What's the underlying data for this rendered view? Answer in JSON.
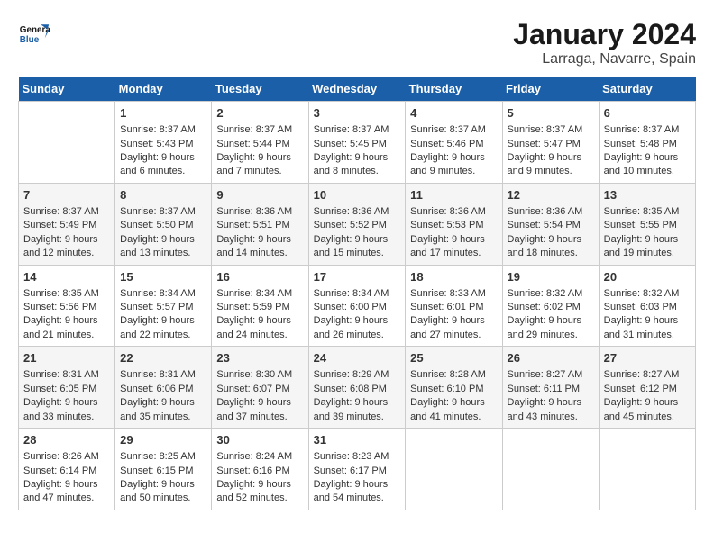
{
  "header": {
    "logo": "GeneralBlue",
    "month": "January 2024",
    "location": "Larraga, Navarre, Spain"
  },
  "columns": [
    "Sunday",
    "Monday",
    "Tuesday",
    "Wednesday",
    "Thursday",
    "Friday",
    "Saturday"
  ],
  "weeks": [
    [
      {
        "day": "",
        "sunrise": "",
        "sunset": "",
        "daylight": ""
      },
      {
        "day": "1",
        "sunrise": "Sunrise: 8:37 AM",
        "sunset": "Sunset: 5:43 PM",
        "daylight": "Daylight: 9 hours and 6 minutes."
      },
      {
        "day": "2",
        "sunrise": "Sunrise: 8:37 AM",
        "sunset": "Sunset: 5:44 PM",
        "daylight": "Daylight: 9 hours and 7 minutes."
      },
      {
        "day": "3",
        "sunrise": "Sunrise: 8:37 AM",
        "sunset": "Sunset: 5:45 PM",
        "daylight": "Daylight: 9 hours and 8 minutes."
      },
      {
        "day": "4",
        "sunrise": "Sunrise: 8:37 AM",
        "sunset": "Sunset: 5:46 PM",
        "daylight": "Daylight: 9 hours and 9 minutes."
      },
      {
        "day": "5",
        "sunrise": "Sunrise: 8:37 AM",
        "sunset": "Sunset: 5:47 PM",
        "daylight": "Daylight: 9 hours and 9 minutes."
      },
      {
        "day": "6",
        "sunrise": "Sunrise: 8:37 AM",
        "sunset": "Sunset: 5:48 PM",
        "daylight": "Daylight: 9 hours and 10 minutes."
      }
    ],
    [
      {
        "day": "7",
        "sunrise": "Sunrise: 8:37 AM",
        "sunset": "Sunset: 5:49 PM",
        "daylight": "Daylight: 9 hours and 12 minutes."
      },
      {
        "day": "8",
        "sunrise": "Sunrise: 8:37 AM",
        "sunset": "Sunset: 5:50 PM",
        "daylight": "Daylight: 9 hours and 13 minutes."
      },
      {
        "day": "9",
        "sunrise": "Sunrise: 8:36 AM",
        "sunset": "Sunset: 5:51 PM",
        "daylight": "Daylight: 9 hours and 14 minutes."
      },
      {
        "day": "10",
        "sunrise": "Sunrise: 8:36 AM",
        "sunset": "Sunset: 5:52 PM",
        "daylight": "Daylight: 9 hours and 15 minutes."
      },
      {
        "day": "11",
        "sunrise": "Sunrise: 8:36 AM",
        "sunset": "Sunset: 5:53 PM",
        "daylight": "Daylight: 9 hours and 17 minutes."
      },
      {
        "day": "12",
        "sunrise": "Sunrise: 8:36 AM",
        "sunset": "Sunset: 5:54 PM",
        "daylight": "Daylight: 9 hours and 18 minutes."
      },
      {
        "day": "13",
        "sunrise": "Sunrise: 8:35 AM",
        "sunset": "Sunset: 5:55 PM",
        "daylight": "Daylight: 9 hours and 19 minutes."
      }
    ],
    [
      {
        "day": "14",
        "sunrise": "Sunrise: 8:35 AM",
        "sunset": "Sunset: 5:56 PM",
        "daylight": "Daylight: 9 hours and 21 minutes."
      },
      {
        "day": "15",
        "sunrise": "Sunrise: 8:34 AM",
        "sunset": "Sunset: 5:57 PM",
        "daylight": "Daylight: 9 hours and 22 minutes."
      },
      {
        "day": "16",
        "sunrise": "Sunrise: 8:34 AM",
        "sunset": "Sunset: 5:59 PM",
        "daylight": "Daylight: 9 hours and 24 minutes."
      },
      {
        "day": "17",
        "sunrise": "Sunrise: 8:34 AM",
        "sunset": "Sunset: 6:00 PM",
        "daylight": "Daylight: 9 hours and 26 minutes."
      },
      {
        "day": "18",
        "sunrise": "Sunrise: 8:33 AM",
        "sunset": "Sunset: 6:01 PM",
        "daylight": "Daylight: 9 hours and 27 minutes."
      },
      {
        "day": "19",
        "sunrise": "Sunrise: 8:32 AM",
        "sunset": "Sunset: 6:02 PM",
        "daylight": "Daylight: 9 hours and 29 minutes."
      },
      {
        "day": "20",
        "sunrise": "Sunrise: 8:32 AM",
        "sunset": "Sunset: 6:03 PM",
        "daylight": "Daylight: 9 hours and 31 minutes."
      }
    ],
    [
      {
        "day": "21",
        "sunrise": "Sunrise: 8:31 AM",
        "sunset": "Sunset: 6:05 PM",
        "daylight": "Daylight: 9 hours and 33 minutes."
      },
      {
        "day": "22",
        "sunrise": "Sunrise: 8:31 AM",
        "sunset": "Sunset: 6:06 PM",
        "daylight": "Daylight: 9 hours and 35 minutes."
      },
      {
        "day": "23",
        "sunrise": "Sunrise: 8:30 AM",
        "sunset": "Sunset: 6:07 PM",
        "daylight": "Daylight: 9 hours and 37 minutes."
      },
      {
        "day": "24",
        "sunrise": "Sunrise: 8:29 AM",
        "sunset": "Sunset: 6:08 PM",
        "daylight": "Daylight: 9 hours and 39 minutes."
      },
      {
        "day": "25",
        "sunrise": "Sunrise: 8:28 AM",
        "sunset": "Sunset: 6:10 PM",
        "daylight": "Daylight: 9 hours and 41 minutes."
      },
      {
        "day": "26",
        "sunrise": "Sunrise: 8:27 AM",
        "sunset": "Sunset: 6:11 PM",
        "daylight": "Daylight: 9 hours and 43 minutes."
      },
      {
        "day": "27",
        "sunrise": "Sunrise: 8:27 AM",
        "sunset": "Sunset: 6:12 PM",
        "daylight": "Daylight: 9 hours and 45 minutes."
      }
    ],
    [
      {
        "day": "28",
        "sunrise": "Sunrise: 8:26 AM",
        "sunset": "Sunset: 6:14 PM",
        "daylight": "Daylight: 9 hours and 47 minutes."
      },
      {
        "day": "29",
        "sunrise": "Sunrise: 8:25 AM",
        "sunset": "Sunset: 6:15 PM",
        "daylight": "Daylight: 9 hours and 50 minutes."
      },
      {
        "day": "30",
        "sunrise": "Sunrise: 8:24 AM",
        "sunset": "Sunset: 6:16 PM",
        "daylight": "Daylight: 9 hours and 52 minutes."
      },
      {
        "day": "31",
        "sunrise": "Sunrise: 8:23 AM",
        "sunset": "Sunset: 6:17 PM",
        "daylight": "Daylight: 9 hours and 54 minutes."
      },
      {
        "day": "",
        "sunrise": "",
        "sunset": "",
        "daylight": ""
      },
      {
        "day": "",
        "sunrise": "",
        "sunset": "",
        "daylight": ""
      },
      {
        "day": "",
        "sunrise": "",
        "sunset": "",
        "daylight": ""
      }
    ]
  ]
}
